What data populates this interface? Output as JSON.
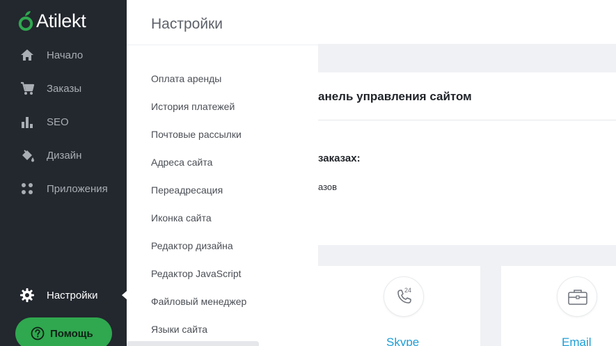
{
  "brand": {
    "name": "Atilekt",
    "accent": "#2fa84f"
  },
  "sidebar": {
    "items": [
      {
        "label": "Начало",
        "icon": "home-icon"
      },
      {
        "label": "Заказы",
        "icon": "cart-icon"
      },
      {
        "label": "SEO",
        "icon": "bar-chart-icon"
      },
      {
        "label": "Дизайн",
        "icon": "paint-bucket-icon"
      },
      {
        "label": "Приложения",
        "icon": "apps-grid-icon"
      }
    ],
    "settings": {
      "label": "Настройки",
      "icon": "gear-icon",
      "active": true
    },
    "help": {
      "label": "Помощь",
      "icon": "help-circle-icon"
    }
  },
  "settings_menu": {
    "title": "Настройки",
    "items": [
      "Оплата аренды",
      "История платежей",
      "Почтовые рассылки",
      "Адреса сайта",
      "Переадресация",
      "Иконка сайта",
      "Редактор дизайна",
      "Редактор JavaScript",
      "Файловый менеджер",
      "Языки сайта"
    ]
  },
  "main": {
    "card_title": "анель управления сайтом",
    "orders_heading": "заказах:",
    "orders_text": "азов",
    "contacts": [
      {
        "label": "Skype",
        "icon": "phone-24-icon"
      },
      {
        "label": "Email",
        "icon": "briefcase-icon"
      }
    ]
  }
}
